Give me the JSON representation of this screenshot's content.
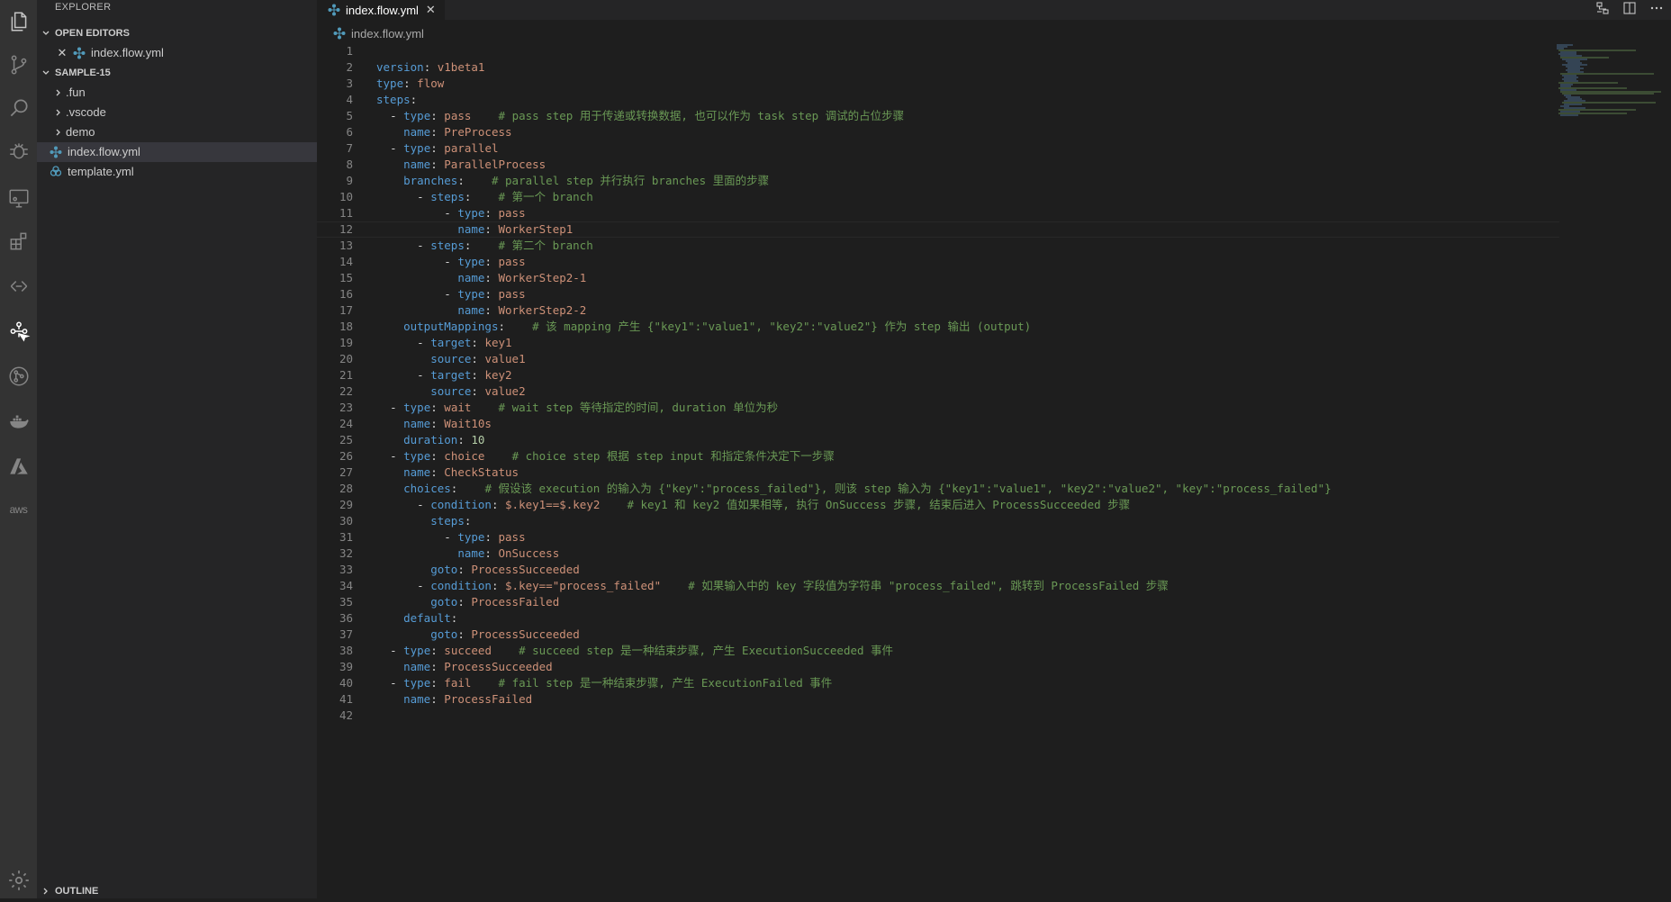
{
  "sidebar": {
    "title": "EXPLORER",
    "open_editors_label": "OPEN EDITORS",
    "open_editors": [
      {
        "label": "index.flow.yml"
      }
    ],
    "project_label": "SAMPLE-15",
    "tree": [
      {
        "label": ".fun",
        "kind": "folder"
      },
      {
        "label": ".vscode",
        "kind": "folder"
      },
      {
        "label": "demo",
        "kind": "folder"
      },
      {
        "label": "index.flow.yml",
        "kind": "flow-file",
        "selected": true
      },
      {
        "label": "template.yml",
        "kind": "template-file"
      }
    ],
    "outline_label": "OUTLINE"
  },
  "editor": {
    "tab_label": "index.flow.yml",
    "breadcrumb": "index.flow.yml",
    "current_line": 12,
    "lines": [
      {
        "num": "1",
        "text": ""
      },
      {
        "num": "2",
        "text": "version: v1beta1"
      },
      {
        "num": "3",
        "text": "type: flow"
      },
      {
        "num": "4",
        "text": "steps:"
      },
      {
        "num": "5",
        "text": "  - type: pass    # pass step 用于传递或转换数据, 也可以作为 task step 调试的占位步骤"
      },
      {
        "num": "6",
        "text": "    name: PreProcess"
      },
      {
        "num": "7",
        "text": "  - type: parallel"
      },
      {
        "num": "8",
        "text": "    name: ParallelProcess"
      },
      {
        "num": "9",
        "text": "    branches:    # parallel step 并行执行 branches 里面的步骤"
      },
      {
        "num": "10",
        "text": "      - steps:    # 第一个 branch"
      },
      {
        "num": "11",
        "text": "          - type: pass"
      },
      {
        "num": "12",
        "text": "            name: WorkerStep1"
      },
      {
        "num": "13",
        "text": "      - steps:    # 第二个 branch"
      },
      {
        "num": "14",
        "text": "          - type: pass"
      },
      {
        "num": "15",
        "text": "            name: WorkerStep2-1"
      },
      {
        "num": "16",
        "text": "          - type: pass"
      },
      {
        "num": "17",
        "text": "            name: WorkerStep2-2"
      },
      {
        "num": "18",
        "text": "    outputMappings:    # 该 mapping 产生 {\"key1\":\"value1\", \"key2\":\"value2\"} 作为 step 输出 (output)"
      },
      {
        "num": "19",
        "text": "      - target: key1"
      },
      {
        "num": "20",
        "text": "        source: value1"
      },
      {
        "num": "21",
        "text": "      - target: key2"
      },
      {
        "num": "22",
        "text": "        source: value2"
      },
      {
        "num": "23",
        "text": "  - type: wait    # wait step 等待指定的时间, duration 单位为秒"
      },
      {
        "num": "24",
        "text": "    name: Wait10s"
      },
      {
        "num": "25",
        "text": "    duration: 10"
      },
      {
        "num": "26",
        "text": "  - type: choice    # choice step 根据 step input 和指定条件决定下一步骤"
      },
      {
        "num": "27",
        "text": "    name: CheckStatus"
      },
      {
        "num": "28",
        "text": "    choices:    # 假设该 execution 的输入为 {\"key\":\"process_failed\"}, 则该 step 输入为 {\"key1\":\"value1\", \"key2\":\"value2\", \"key\":\"process_failed\"}"
      },
      {
        "num": "29",
        "text": "      - condition: $.key1==$.key2    # key1 和 key2 值如果相等, 执行 OnSuccess 步骤, 结束后进入 ProcessSucceeded 步骤"
      },
      {
        "num": "30",
        "text": "        steps:"
      },
      {
        "num": "31",
        "text": "          - type: pass"
      },
      {
        "num": "32",
        "text": "            name: OnSuccess"
      },
      {
        "num": "33",
        "text": "        goto: ProcessSucceeded"
      },
      {
        "num": "34",
        "text": "      - condition: $.key==\"process_failed\"    # 如果输入中的 key 字段值为字符串 \"process_failed\", 跳转到 ProcessFailed 步骤"
      },
      {
        "num": "35",
        "text": "        goto: ProcessFailed"
      },
      {
        "num": "36",
        "text": "    default:"
      },
      {
        "num": "37",
        "text": "        goto: ProcessSucceeded"
      },
      {
        "num": "38",
        "text": "  - type: succeed    # succeed step 是一种结束步骤, 产生 ExecutionSucceeded 事件"
      },
      {
        "num": "39",
        "text": "    name: ProcessSucceeded"
      },
      {
        "num": "40",
        "text": "  - type: fail    # fail step 是一种结束步骤, 产生 ExecutionFailed 事件"
      },
      {
        "num": "41",
        "text": "    name: ProcessFailed"
      },
      {
        "num": "42",
        "text": ""
      }
    ]
  },
  "activity_bar": {
    "icons": [
      "files-icon",
      "source-control-icon",
      "search-icon",
      "debug-icon",
      "remote-explorer-icon",
      "extensions-icon",
      "gitlens-icon",
      "fun-flow-icon",
      "git-graph-icon",
      "docker-icon",
      "azure-icon",
      "aws-icon"
    ],
    "settings_icon": "gear-icon",
    "aws_label": "aws"
  },
  "colors": {
    "keyword": "#569cd6",
    "string": "#ce9178",
    "comment": "#6a9955",
    "number": "#b5cea8",
    "line_number": "#858585",
    "flow_icon": "#519aba"
  }
}
